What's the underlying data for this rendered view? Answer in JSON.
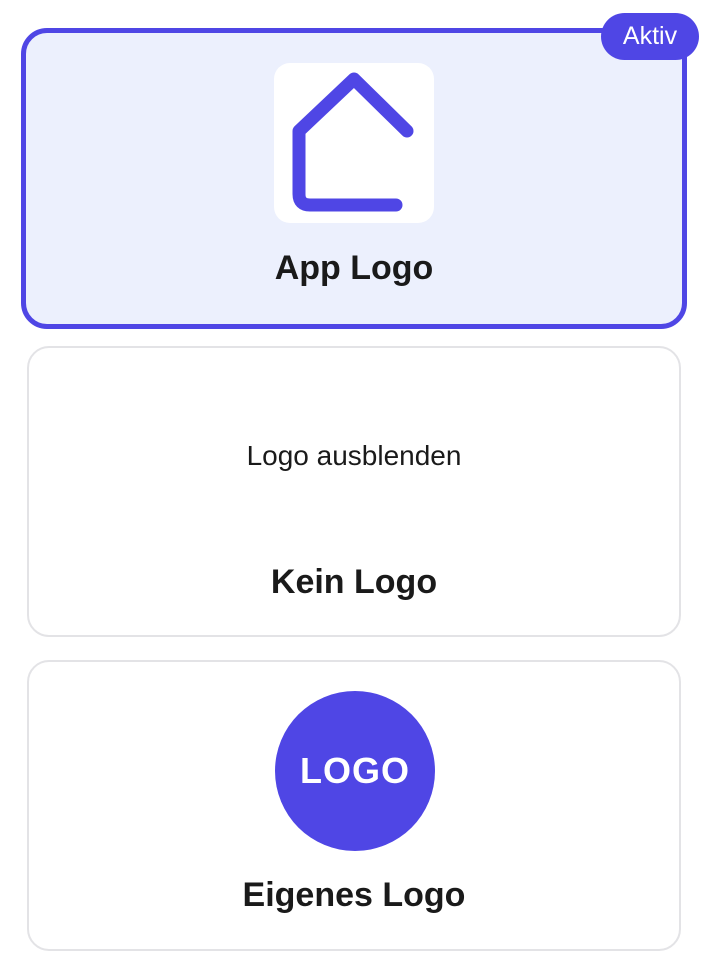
{
  "colors": {
    "accent": "#4f46e5",
    "active_card_background": "#ecf0fd",
    "card_border": "#e3e3e6"
  },
  "logo_options": [
    {
      "title": "App Logo",
      "badge": "Aktiv",
      "icon": "house-icon",
      "selected": true
    },
    {
      "title": "Kein Logo",
      "hint": "Logo ausblenden",
      "selected": false
    },
    {
      "title": "Eigenes Logo",
      "placeholder_text": "LOGO",
      "selected": false
    }
  ]
}
